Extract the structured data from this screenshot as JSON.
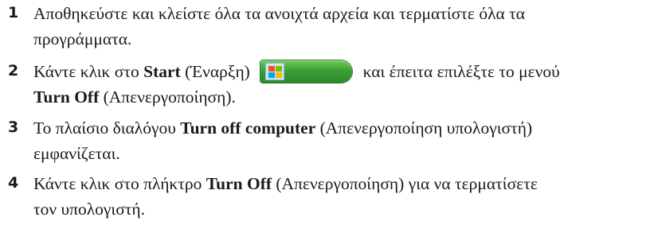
{
  "steps": [
    {
      "number": "1",
      "line1": "Αποθηκεύστε και κλείστε όλα τα ανοιχτά αρχεία και τερματίστε όλα τα",
      "line2": "προγράμματα."
    },
    {
      "number": "2",
      "part1": "Κάντε κλικ στο ",
      "bold1": "Start",
      "part2": " (Έναρξη) ",
      "part3": " και έπειτα επιλέξτε το μενού",
      "bold2": "Turn Off",
      "part4": " (Απενεργοποίηση)."
    },
    {
      "number": "3",
      "part1": "Το πλαίσιο διαλόγου ",
      "bold1": "Turn off computer",
      "part2": " (Απενεργοποίηση υπολογιστή)",
      "line2": "εμφανίζεται."
    },
    {
      "number": "4",
      "part1": "Κάντε κλικ στο πλήκτρο ",
      "bold1": "Turn Off",
      "part2": " (Απενεργοποίηση) για να τερματίσετε",
      "line2": "τον υπολογιστή."
    }
  ],
  "icons": {
    "start_button": "windows-start-button-icon"
  },
  "colors": {
    "start_button_green": "#3a9f34"
  }
}
